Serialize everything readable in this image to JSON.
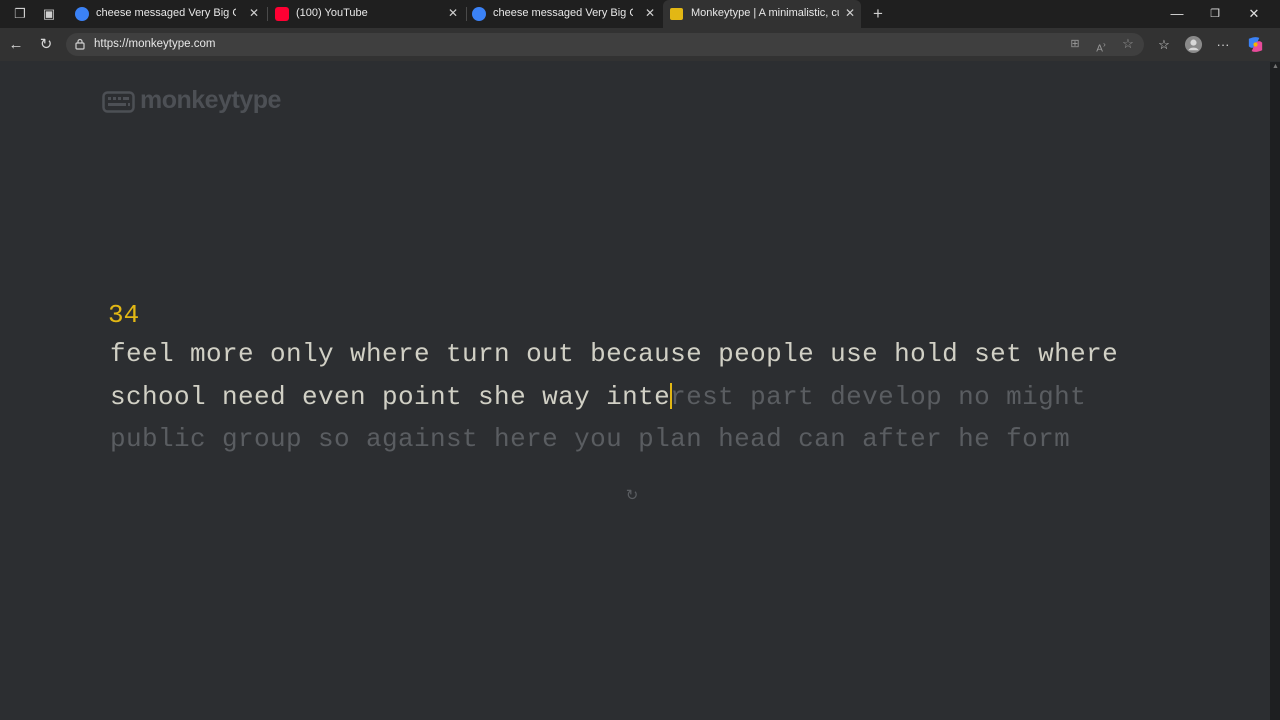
{
  "browser": {
    "tabs": [
      {
        "title": "cheese messaged Very Big GC",
        "favicon": "messenger-icon",
        "favicon_color": "#3b82f6"
      },
      {
        "title": "(100) YouTube",
        "favicon": "youtube-icon",
        "favicon_color": "#ff0033"
      },
      {
        "title": "cheese messaged Very Big GC",
        "favicon": "messenger-icon",
        "favicon_color": "#3b82f6"
      },
      {
        "title": "Monkeytype | A minimalistic, cust",
        "favicon": "monkeytype-icon",
        "favicon_color": "#e2b714"
      }
    ],
    "url": "https://monkeytype.com"
  },
  "app": {
    "logo": "monkeytype",
    "word_counter": "34",
    "line1": "feel more only where turn out because people use hold set where",
    "line2_typed": "school need even point she way inte",
    "line2_current_char": "r",
    "line2_rest": "est part develop no might",
    "line3": "public group so against here you plan head can after he form"
  },
  "colors": {
    "accent": "#e2b714",
    "text": "#d1d0c5",
    "untyped": "#5a5d61",
    "background": "#2c2e31"
  }
}
